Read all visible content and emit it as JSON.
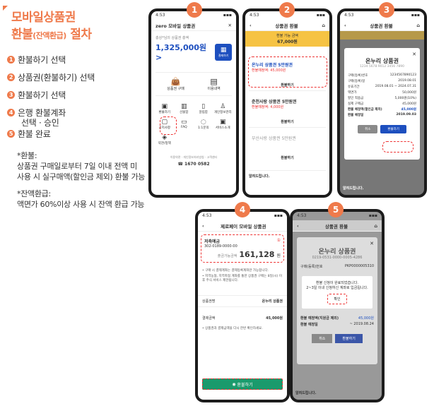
{
  "heading": {
    "line1": "모바일상품권",
    "line2_main": "환불",
    "line2_small": "(잔액환급)",
    "line2_suffix": " 절차"
  },
  "steps": [
    {
      "num": "1",
      "text": "환불하기 선택"
    },
    {
      "num": "2",
      "text": "상품권(환불하기) 선택"
    },
    {
      "num": "3",
      "text": "환불하기 선택"
    },
    {
      "num": "4",
      "text": "은행 환불계좌"
    },
    {
      "num": "",
      "text": "선택 · 승인"
    },
    {
      "num": "5",
      "text": "환불 완료"
    }
  ],
  "notes": {
    "refund_title": "*환불:",
    "refund_body1": "상품권 구매일로부터 7일 이내 전액 미",
    "refund_body2": "사용 시 실구매액(할인금 제외) 환불 가능",
    "balance_title": "*잔액환급:",
    "balance_body": "액면가 60%이상 사용 시 잔액 환급 가능"
  },
  "phone1": {
    "badge": "1",
    "time": "4:53",
    "brand": "zero 모바일 상품권",
    "balance_label": "총상*님의 상품권 총액",
    "balance": "1,325,000원 >",
    "qr_label": "결제하기",
    "buy_label": "상품권 구매",
    "history_label": "이용내역",
    "menu": [
      "환불하기",
      "선물함",
      "알림함",
      "개인정보관리",
      "공지사항",
      "FAQ",
      "1:1문의",
      "서비스소개",
      "약관/정책"
    ],
    "footer1": "이용약관 · 개인정보처리방침 · 고객센터",
    "phone": "1670 0582"
  },
  "phone2": {
    "badge": "2",
    "title": "상품권 환불",
    "refund_avail_label": "환불 가능 금액",
    "refund_avail": "67,000원",
    "item1_name": "온누리 상품권 5만원권",
    "item1_amount": "환불예정액: 45,000원",
    "item1_btn": "환불하기",
    "item2_name": "춘천사랑 상품권 5만원권",
    "item2_amount": "환불예정액: 4,000원",
    "item2_btn": "환불하기",
    "item3_name": "부산사랑 상품권 5만원권",
    "item3_btn": "환불하기",
    "notice": "알려드립니다."
  },
  "phone3": {
    "badge": "3",
    "title": "상품권 환불",
    "modal_title": "온누리 상품권",
    "modal_sub": "1234 5678 9012 3456 7890",
    "rows": [
      {
        "k": "구매(등록)번호",
        "v": "1234567890123"
      },
      {
        "k": "구매(등록)일",
        "v": "2019.08.01"
      },
      {
        "k": "유효기간",
        "v": "2019.08.01 ~ 2024.07.31"
      },
      {
        "k": "액면가",
        "v": "50,000원"
      },
      {
        "k": "할인 적용금",
        "v": "5,000원(10%)"
      },
      {
        "k": "실제 구매금",
        "v": "45,000원"
      },
      {
        "k": "환불 예정액(할인금 제외)",
        "v": "45,000원"
      },
      {
        "k": "환불 예정일",
        "v": "2019.09.03"
      }
    ],
    "cancel": "취소",
    "confirm": "환불하기",
    "notice": "알려드립니다."
  },
  "phone4": {
    "badge": "4",
    "title": "제로페이 모바일 상품권",
    "account_type": "저축예금",
    "account_no": "302-0189-0000-00",
    "circle_num": "①",
    "amount_label": "출금가능금액",
    "amount": "161,128",
    "amount_unit": "원",
    "info1": "• 구매 시 결제계좌는 결제등록계좌만 가능합니다.",
    "info2": "• 지역농협, 지역축협 계좌를 통한 상품권 구매는 8일(시) 이후 주식 서비스 제한됩니다.",
    "product_label": "상품권명",
    "product_value": "온누리 상품권",
    "refund_label": "결제금액",
    "refund_value": "45,000원",
    "warn": "• 상품권과 결제금액을 다시 한번 확인하세요.",
    "button": "환불하기"
  },
  "phone5": {
    "badge": "5",
    "title": "상품권 환불",
    "modal_title": "온누리 상품권",
    "modal_sub": "0219-0531-0000-0005-4286",
    "reg_label": "구매(등록)번호",
    "reg_value": "PKP0000005310",
    "done1": "환불 신청이 완료되었습니다.",
    "done2": "2~3일 이내 신청하신 계좌로 입금됩니다.",
    "ok": "확인",
    "r1_label": "환불 예정액(지원금 제외)",
    "r1_value": "45,000원",
    "r2_label": "환불 예정일",
    "r2_value": "~ 2019.08.24",
    "cancel": "취소",
    "confirm": "환불하기",
    "notice": "알려드립니다."
  },
  "colors": {
    "accent": "#ef7a4b",
    "highlight": "#e33",
    "yellow": "#f6c343",
    "green": "#1a9a6c"
  }
}
